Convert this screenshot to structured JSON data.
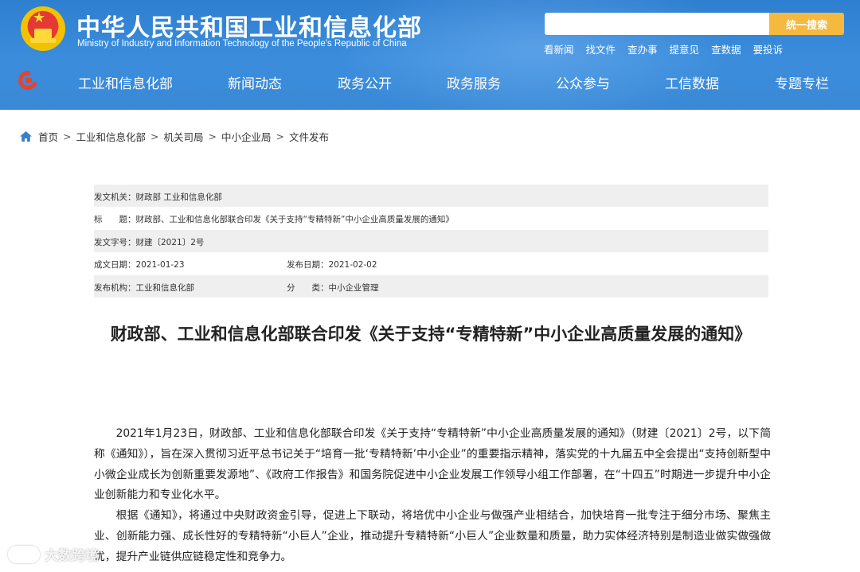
{
  "header": {
    "title": "中华人民共和国工业和信息化部",
    "subtitle": "Ministry of Industry and Information Technology of the People's Republic of China",
    "search": {
      "placeholder": "",
      "button": "统一搜索"
    },
    "quick_links": [
      "看新闻",
      "找文件",
      "查办事",
      "提意见",
      "查数据",
      "要投诉"
    ],
    "nav": [
      "工业和信息化部",
      "新闻动态",
      "政务公开",
      "政务服务",
      "公众参与",
      "工信数据",
      "专题专栏"
    ],
    "colors": {
      "header_bg": "#3a89d6",
      "search_button": "#f4b93e",
      "nav_logo": "#e8412c"
    }
  },
  "breadcrumb": [
    "首页",
    "工业和信息化部",
    "机关司局",
    "中小企业局",
    "文件发布"
  ],
  "meta": {
    "issuer": "发文机关：财政部 工业和信息化部",
    "title": "标　　题：财政部、工业和信息化部联合印发《关于支持“专精特新”中小企业高质量发展的通知》",
    "doc_no": "发文字号：财建〔2021〕2号",
    "date_written": "成文日期：2021-01-23",
    "date_published": "发布日期：2021-02-02",
    "publisher": "发布机构：工业和信息化部",
    "category": "分　　类：中小企业管理"
  },
  "article": {
    "title": "财政部、工业和信息化部联合印发《关于支持“专精特新”中小企业高质量发展的通知》",
    "paragraphs": [
      "2021年1月23日，财政部、工业和信息化部联合印发《关于支持“专精特新”中小企业高质量发展的通知》（财建〔2021〕2号，以下简称《通知》），旨在深入贯彻习近平总书记关于“培育一批‘专精特新’中小企业”的重要指示精神，落实党的十九届五中全会提出“支持创新型中小微企业成长为创新重要发源地”、《政府工作报告》和国务院促进中小企业发展工作领导小组工作部署，在“十四五”时期进一步提升中小企业创新能力和专业化水平。",
      "根据《通知》，将通过中央财政资金引导，促进上下联动，将培优中小企业与做强产业相结合，加快培育一批专注于细分市场、聚焦主业、创新能力强、成长性好的专精特新“小巨人”企业，推动提升专精特新“小巨人”企业数量和质量，助力实体经济特别是制造业做实做强做优，提升产业链供应链稳定性和竞争力。"
    ]
  },
  "watermark": "大数跨境"
}
